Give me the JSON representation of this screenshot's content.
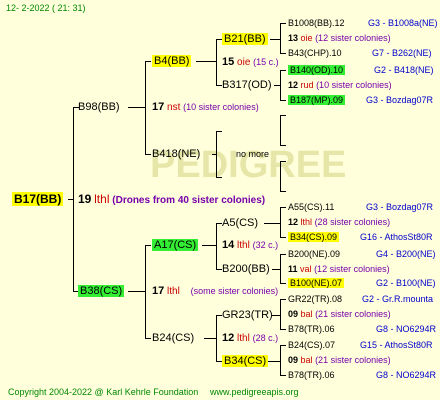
{
  "date_label": "12-  2-2022  ( 21: 31)",
  "watermark": "PEDIGREE",
  "root": {
    "name": "B17(BB)",
    "num": "19",
    "tag": "lthl",
    "context": "(Drones from 40 sister colonies)"
  },
  "g2": [
    {
      "name": "B98(BB)"
    },
    {
      "name": "B38(CS)"
    }
  ],
  "g3": [
    {
      "name": "B4(BB)"
    },
    {
      "num": "17",
      "tag": "nst",
      "context": "(10 sister colonies)"
    },
    {
      "name": "B418(NE)"
    },
    {
      "name": "A17(CS)"
    },
    {
      "num": "17",
      "tag": "lthl",
      "context": "(some sister colonies)"
    },
    {
      "name": "B24(CS)"
    }
  ],
  "g4": [
    {
      "name": "B21(BB)"
    },
    {
      "num": "15",
      "tag": "oie",
      "context": "(15 c.)"
    },
    {
      "name": "B317(OD)"
    },
    {
      "name": "no more"
    },
    {
      "name": "A5(CS)"
    },
    {
      "num": "14",
      "tag": "lthl",
      "context": "(32 c.)"
    },
    {
      "name": "B200(BB)"
    },
    {
      "name": "GR23(TR)"
    },
    {
      "num": "12",
      "tag": "lthl",
      "context": "(28 c.)"
    },
    {
      "name": "B34(CS)"
    }
  ],
  "g5": [
    {
      "name": "B1008(BB).12",
      "ref": "G3 - B1008a(NE)"
    },
    {
      "num": "13",
      "tag": "oie",
      "context": "(12 sister colonies)"
    },
    {
      "name": "B43(CHP).10",
      "ref": "G7 - B262(NE)"
    },
    {
      "name": "B140(OD).10",
      "ref": "G2 - B418(NE)"
    },
    {
      "num": "12",
      "tag": "rud",
      "context": "(10 sister colonies)"
    },
    {
      "name": "B187(MP).09",
      "ref": "G3 - Bozdag07R"
    },
    {
      "name": "A55(CS).11",
      "ref": "G3 - Bozdag07R"
    },
    {
      "num": "12",
      "tag": "lthl",
      "context": "(28 sister colonies)"
    },
    {
      "name": "B34(CS).09",
      "ref": "G16 - AthosSt80R"
    },
    {
      "name": "B200(NE).09",
      "ref": "G4 - B200(NE)"
    },
    {
      "num": "11",
      "tag": "val",
      "context": "(12 sister colonies)"
    },
    {
      "name": "B100(NE).07",
      "ref": "G2 - B100(NE)"
    },
    {
      "name": "GR22(TR).08",
      "ref": "G2 - Gr.R.mounta"
    },
    {
      "num": "09",
      "tag": "bal",
      "context": "(21 sister colonies)"
    },
    {
      "name": "B78(TR).06",
      "ref": "G8 - NO6294R"
    },
    {
      "name": "B24(CS).07",
      "ref": "G15 - AthosSt80R"
    },
    {
      "num": "09",
      "tag": "bal",
      "context": "(21 sister colonies)"
    },
    {
      "name": "B78(TR).06",
      "ref": "G8 - NO6294R"
    }
  ],
  "footer": "Copyright 2004-2022 @ Karl Kehrle Foundation",
  "site": "www.pedigreeapis.org",
  "colors": {
    "background": "#ffffdc",
    "highlight_yellow": "#ffff00",
    "highlight_green": "#33ee33",
    "footer_green": "#008800"
  }
}
